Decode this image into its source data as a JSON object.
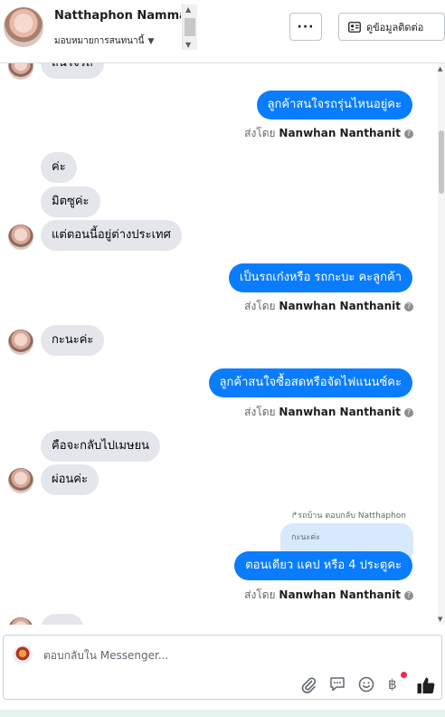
{
  "header": {
    "contact_name": "Natthaphon Nammala",
    "assign_label": "มอบหมายการสนทนานี้",
    "more_label": "···",
    "view_contact_label": "ดูข้อมูลติดต่อ"
  },
  "messages": [
    {
      "dir": "in",
      "text": "สนใจรถ",
      "avatar": true
    },
    {
      "dir": "out",
      "text": "ลูกค้าสนใจรถรุ่นไหนอยู่คะ"
    },
    {
      "dir": "in",
      "text": "ค่ะ",
      "avatar": false
    },
    {
      "dir": "in",
      "text": "มิตซูค่ะ",
      "avatar": false
    },
    {
      "dir": "in",
      "text": "แต่ตอนนี้อยู่ต่างประเทศ",
      "avatar": true
    },
    {
      "dir": "out",
      "text": "เป็นรถเก๋งหรือ รถกะบะ คะลูกค้า"
    },
    {
      "dir": "in",
      "text": "กะนะค่ะ",
      "avatar": true
    },
    {
      "dir": "out",
      "text": "ลูกค้าสนใจซื้อสดหรือจัดไฟแนนซ์คะ"
    },
    {
      "dir": "in",
      "text": "คือจะกลับไปเมษยน",
      "avatar": false
    },
    {
      "dir": "in",
      "text": "ผ่อนค่ะ",
      "avatar": true
    },
    {
      "dir": "out",
      "text": "ตอนเดียว แคป หรือ 4 ประตูคะ"
    }
  ],
  "sent_by_prefix": "ส่งโดย",
  "sender_name": "Nanwhan Nanthanit",
  "reply": {
    "label": "รถบ้าน ตอบกลับ Natthaphon",
    "quoted_text": "กะนะค่ะ"
  },
  "composer": {
    "placeholder": "ตอบกลับใน Messenger..."
  },
  "icons": [
    "paperclip-icon",
    "chat-bubble-icon",
    "emoji-icon",
    "baht-payment-icon",
    "thumbs-up-icon",
    "info-icon",
    "contact-card-icon",
    "caret-down-icon"
  ],
  "colors": {
    "outgoing_bubble": "#0a7cff",
    "incoming_bubble": "#e4e6eb",
    "notification_dot": "#f02849"
  }
}
